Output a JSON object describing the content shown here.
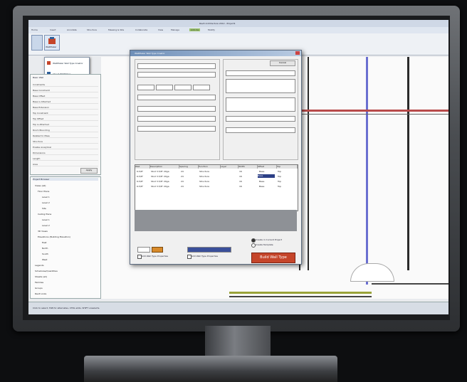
{
  "window": {
    "title": "Revit Architecture 2012 - Project1"
  },
  "ribbon_tabs": [
    "Home",
    "Insert",
    "Annotate",
    "Structure",
    "Massing & Site",
    "Collaborate",
    "View",
    "Manage",
    "Add-Ins",
    "Modify"
  ],
  "ribbon_group": "WallMaker",
  "menu_items": [
    "WallMaker Wall Type Creator",
    "About WallMaker"
  ],
  "properties": {
    "header": "Basic Wall",
    "rows": [
      "Constraints",
      "Base Constraint",
      "Base Offset",
      "Base is Attached",
      "Base Extension",
      "Top Constraint",
      "Top Offset",
      "Top is Attached",
      "Room Bounding",
      "Related to Mass",
      "Structure",
      "Enable Analytical",
      "Dimensions",
      "Length",
      "Area"
    ],
    "apply": "Apply"
  },
  "browser": {
    "header": "Project Browser",
    "items": [
      "Views (all)",
      "Floor Plans",
      "Level 1",
      "Level 2",
      "Site",
      "Ceiling Plans",
      "Level 1",
      "Level 2",
      "3D Views",
      "Elevations (Building Elevation)",
      "East",
      "North",
      "South",
      "West",
      "Legends",
      "Schedules/Quantities",
      "Sheets (all)",
      "Families",
      "Groups",
      "Revit Links"
    ]
  },
  "dialog": {
    "title": "WallMaker Wall Type Creator",
    "cancel": "Cancel",
    "build_button": "Build Wall Type",
    "radio_1": "Create in Current Project",
    "radio_2": "Create Template",
    "check_1": "Add Wall Type Properties",
    "check_2": "Add Wall Type Properties",
    "grid_headers": [
      "Wall",
      "Description",
      "Spacing",
      "Function",
      "Layer",
      "Width",
      "Offset",
      "Top"
    ],
    "grid_rows": [
      [
        "6-5/8\"",
        "Stud 3-5/8\" 20ga",
        "24",
        "Structure",
        "16",
        "Base",
        "Top"
      ],
      [
        "6-5/8\"",
        "Stud 3-5/8\" 20ga",
        "24",
        "Structure",
        "16",
        "Base",
        "Top"
      ],
      [
        "6-5/8\"",
        "Stud 3-5/8\" 20ga",
        "24",
        "Structure",
        "16",
        "Base",
        "Top"
      ],
      [
        "6-5/8\"",
        "Stud 3-5/8\" 20ga",
        "24",
        "Structure",
        "16",
        "Base",
        "Top"
      ]
    ]
  },
  "status": {
    "text": "Click to select, TAB for alternates, CTRL adds, SHIFT unselects."
  },
  "colors": {
    "accent": "#c5452a",
    "ribbon": "#eef1f5",
    "bezel": "#4a4d51"
  }
}
